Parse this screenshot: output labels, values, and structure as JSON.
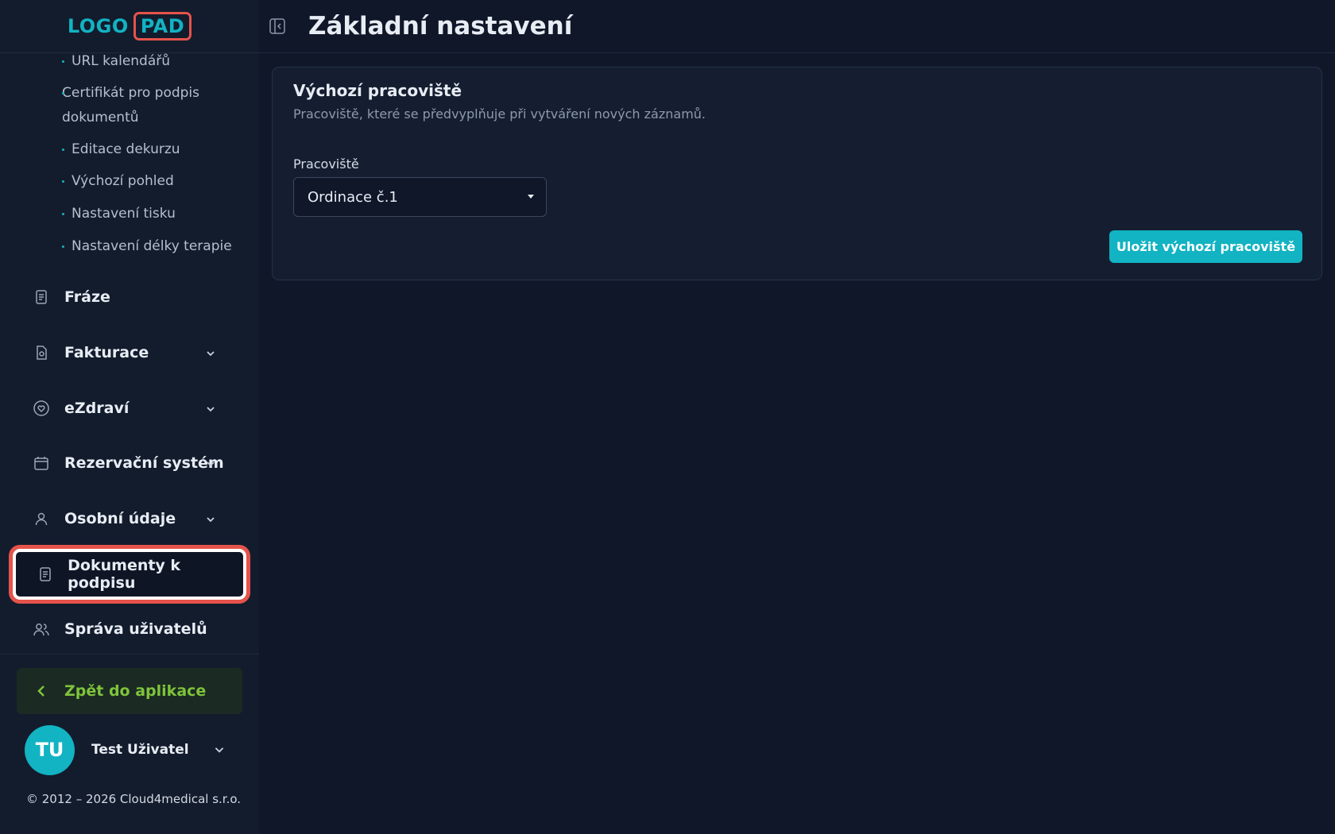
{
  "app": {
    "logo_left": "LOGO",
    "logo_right": "PAD"
  },
  "sidebar": {
    "sub_items": [
      {
        "label": "URL kalendářů"
      },
      {
        "label": "Certifikát pro podpis dokumentů"
      },
      {
        "label": "Editace dekurzu"
      },
      {
        "label": "Výchozí pohled"
      },
      {
        "label": "Nastavení tisku"
      },
      {
        "label": "Nastavení délky terapie"
      }
    ],
    "items": [
      {
        "label": "Fráze",
        "icon": "document-icon"
      },
      {
        "label": "Fakturace",
        "icon": "invoice-icon",
        "expandable": true
      },
      {
        "label": "eZdraví",
        "icon": "heart-icon",
        "expandable": true
      },
      {
        "label": "Rezervační systém",
        "icon": "calendar-icon",
        "expandable": true
      },
      {
        "label": "Osobní údaje",
        "icon": "user-icon",
        "expandable": true
      },
      {
        "label": "Dokumenty k podpisu",
        "icon": "document-icon",
        "active": true
      },
      {
        "label": "Správa uživatelů",
        "icon": "users-icon"
      }
    ],
    "back_button": "Zpět do aplikace",
    "user": {
      "initials": "TU",
      "name": "Test Uživatel"
    },
    "copyright": "© 2012 – 2026 Cloud4medical s.r.o."
  },
  "header": {
    "title": "Základní nastavení"
  },
  "card": {
    "title": "Výchozí pracoviště",
    "description": "Pracoviště, které se předvyplňuje při vytváření nových záznamů.",
    "field_label": "Pracoviště",
    "selected_value": "Ordinace č.1",
    "save_button": "Uložit výchozí pracoviště"
  },
  "colors": {
    "accent": "#12b3c2",
    "highlight": "#e5534b",
    "back_button_text": "#7ec43c",
    "background": "#0f1729"
  }
}
